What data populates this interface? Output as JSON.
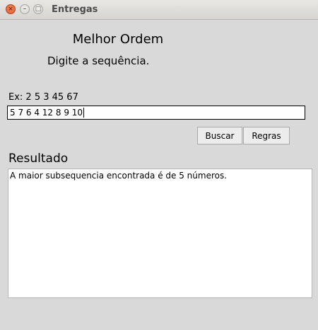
{
  "window": {
    "title": "Entregas",
    "controls": {
      "close": "×",
      "minimize": "–",
      "maximize": "□"
    }
  },
  "form": {
    "heading": "Melhor Ordem",
    "instruction": "Digite a sequência.",
    "example": "Ex: 2 5 3 45 67",
    "sequence_value": "5 7 6 4 12 8 9 10",
    "search_label": "Buscar",
    "rules_label": "Regras"
  },
  "result": {
    "label": "Resultado",
    "text": "A maior subsequencia encontrada é de 5 números."
  }
}
